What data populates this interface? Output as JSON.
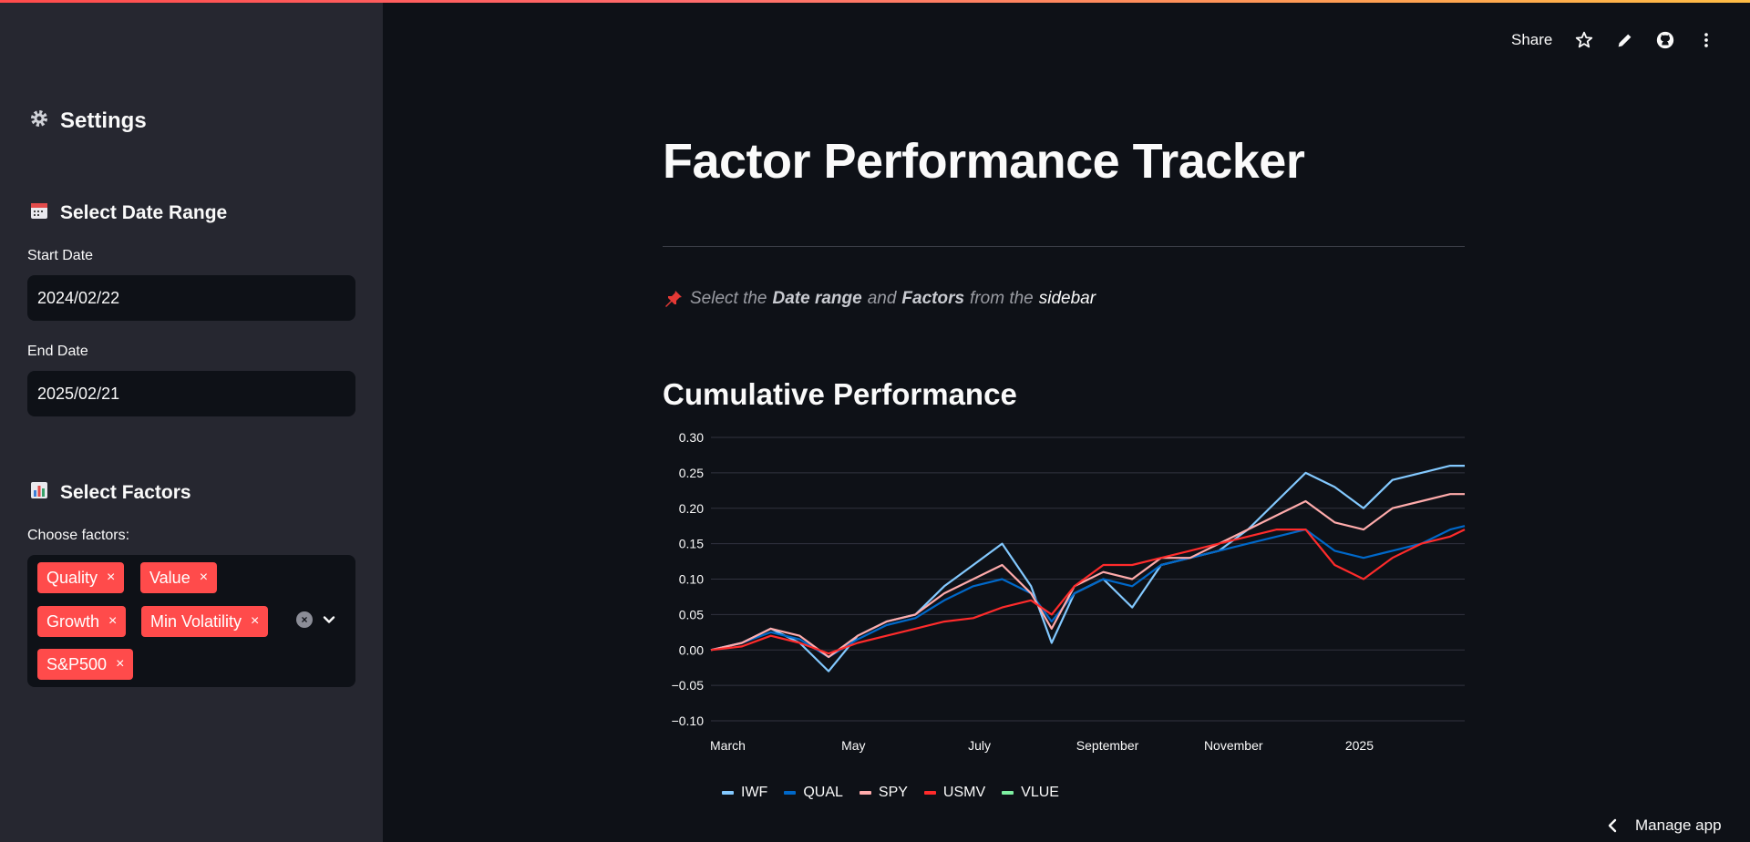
{
  "sidebar": {
    "title": "Settings",
    "title_icon": "gear-icon",
    "date_section": {
      "title": "Select Date Range",
      "icon": "calendar-icon"
    },
    "start_date": {
      "label": "Start Date",
      "value": "2024/02/22"
    },
    "end_date": {
      "label": "End Date",
      "value": "2025/02/21"
    },
    "factor_section": {
      "title": "Select Factors",
      "icon": "bar-chart-icon"
    },
    "factors": {
      "label": "Choose factors:",
      "selected": [
        "Quality",
        "Value",
        "Growth",
        "Min Volatility",
        "S&P500"
      ],
      "remove_symbol": "×"
    }
  },
  "toolbar": {
    "share_label": "Share",
    "icons": [
      "star-icon",
      "pencil-icon",
      "github-icon",
      "more-vertical-icon"
    ]
  },
  "main": {
    "title": "Factor Performance Tracker",
    "instruction": {
      "prefix": "Select the",
      "bold1": "Date range",
      "mid": "and",
      "bold2": "Factors",
      "suffix": "from the",
      "highlight": "sidebar"
    },
    "section_title": "Cumulative Performance"
  },
  "chart_data": {
    "type": "line",
    "title": "",
    "xlabel": "",
    "ylabel": "",
    "x_ticks": [
      "March",
      "May",
      "July",
      "September",
      "November",
      "2025"
    ],
    "y_ticks": [
      "0.30",
      "0.25",
      "0.20",
      "0.15",
      "0.10",
      "0.05",
      "0.00",
      "−0.10",
      "−0.05"
    ],
    "ylim": [
      -0.1,
      0.3
    ],
    "x": [
      "2024-02-22",
      "2024-03-08",
      "2024-03-22",
      "2024-04-05",
      "2024-04-19",
      "2024-05-03",
      "2024-05-17",
      "2024-05-31",
      "2024-06-14",
      "2024-06-28",
      "2024-07-12",
      "2024-07-26",
      "2024-08-05",
      "2024-08-16",
      "2024-08-30",
      "2024-09-13",
      "2024-09-27",
      "2024-10-11",
      "2024-10-25",
      "2024-11-08",
      "2024-11-22",
      "2024-12-06",
      "2024-12-20",
      "2025-01-03",
      "2025-01-17",
      "2025-01-31",
      "2025-02-14",
      "2025-02-21"
    ],
    "series": [
      {
        "name": "IWF",
        "color": "#83c9ff",
        "values": [
          0.0,
          0.01,
          0.03,
          0.01,
          -0.03,
          0.02,
          0.04,
          0.05,
          0.09,
          0.12,
          0.15,
          0.09,
          0.01,
          0.08,
          0.1,
          0.06,
          0.12,
          0.13,
          0.14,
          0.17,
          0.21,
          0.25,
          0.23,
          0.2,
          0.24,
          0.25,
          0.26,
          0.26
        ]
      },
      {
        "name": "QUAL",
        "color": "#0068c9",
        "values": [
          0.0,
          0.01,
          0.025,
          0.015,
          -0.01,
          0.015,
          0.035,
          0.045,
          0.07,
          0.09,
          0.1,
          0.08,
          0.04,
          0.08,
          0.1,
          0.09,
          0.12,
          0.13,
          0.14,
          0.15,
          0.16,
          0.17,
          0.14,
          0.13,
          0.14,
          0.15,
          0.17,
          0.175
        ]
      },
      {
        "name": "SPY",
        "color": "#ffabab",
        "values": [
          0.0,
          0.01,
          0.03,
          0.02,
          -0.01,
          0.02,
          0.04,
          0.05,
          0.08,
          0.1,
          0.12,
          0.08,
          0.03,
          0.09,
          0.11,
          0.1,
          0.13,
          0.13,
          0.15,
          0.17,
          0.19,
          0.21,
          0.18,
          0.17,
          0.2,
          0.21,
          0.22,
          0.22
        ]
      },
      {
        "name": "USMV",
        "color": "#ff2b2b",
        "values": [
          0.0,
          0.005,
          0.02,
          0.01,
          -0.005,
          0.01,
          0.02,
          0.03,
          0.04,
          0.045,
          0.06,
          0.07,
          0.05,
          0.09,
          0.12,
          0.12,
          0.13,
          0.14,
          0.15,
          0.16,
          0.17,
          0.17,
          0.12,
          0.1,
          0.13,
          0.15,
          0.16,
          0.17
        ]
      },
      {
        "name": "VLUE",
        "color": "#7defa1",
        "values": []
      }
    ]
  }
}
